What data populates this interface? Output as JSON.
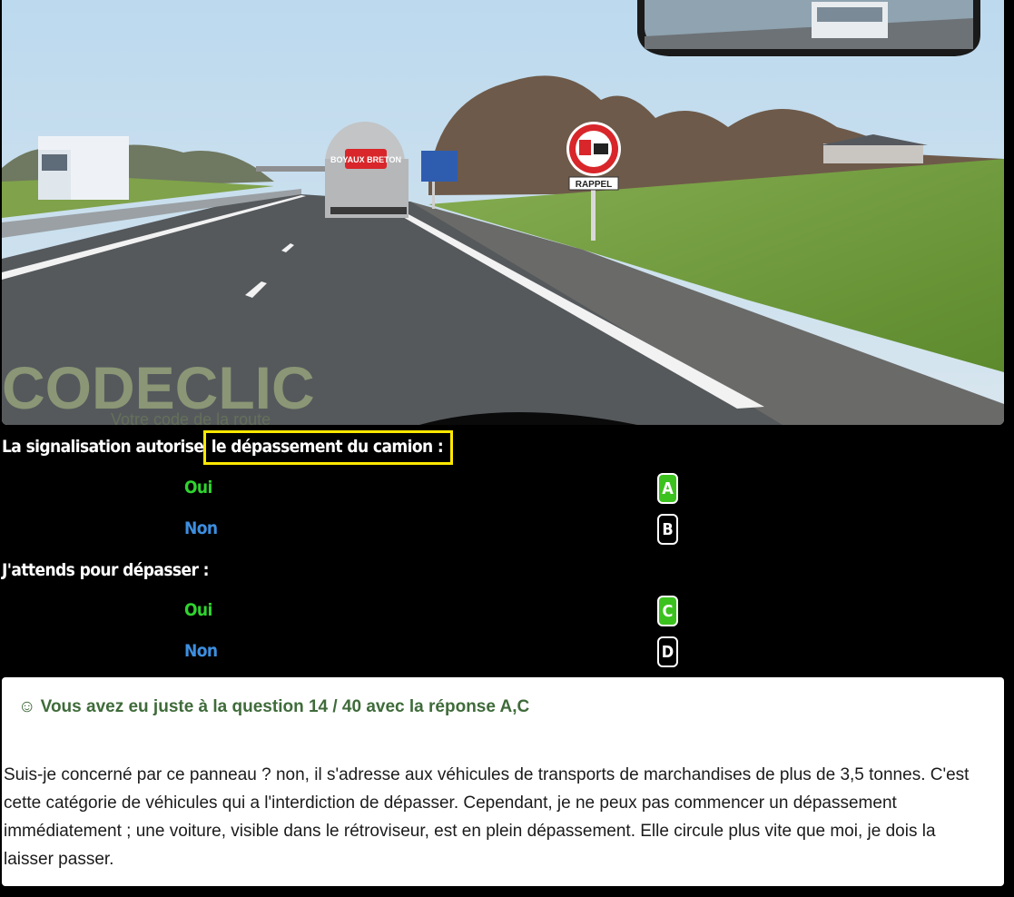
{
  "scene": {
    "sign_label": "RAPPEL",
    "truck_logo": "BOYAUX BRETON",
    "watermark": "CODECLIC",
    "watermark_sub": "Votre code de la route",
    "colors": {
      "sky": "#a9cde6",
      "road": "#55595c",
      "grass": "#6f9a3c",
      "sign_red": "#d8262a"
    }
  },
  "questions": [
    {
      "text_plain": "La signalisation autorise",
      "text_highlight": "le dépassement du camion :",
      "answers": [
        {
          "label": "Oui",
          "letter": "A",
          "selected": true
        },
        {
          "label": "Non",
          "letter": "B",
          "selected": false
        }
      ]
    },
    {
      "text_plain": "J'attends pour dépasser :",
      "answers": [
        {
          "label": "Oui",
          "letter": "C",
          "selected": true
        },
        {
          "label": "Non",
          "letter": "D",
          "selected": false
        }
      ]
    }
  ],
  "result": {
    "title": "☺ Vous avez eu juste à la question 14 / 40 avec la réponse A,C",
    "explanation": "Suis-je concerné par ce panneau ? non, il s'adresse aux véhicules de transports de marchandises de plus de 3,5 tonnes. C'est cette catégorie de véhicules qui a l'interdiction de dépasser. Cependant, je ne peux pas commencer un dépassement immédiatement ; une voiture, visible dans le rétroviseur, est en plein dépassement. Elle circule plus vite que moi, je dois la laisser passer."
  },
  "colors": {
    "selected": "#3cc21e",
    "oui": "#2fd42f",
    "non": "#3d8fe0",
    "highlight": "#ffe800",
    "result_title": "#3f6b3a"
  }
}
